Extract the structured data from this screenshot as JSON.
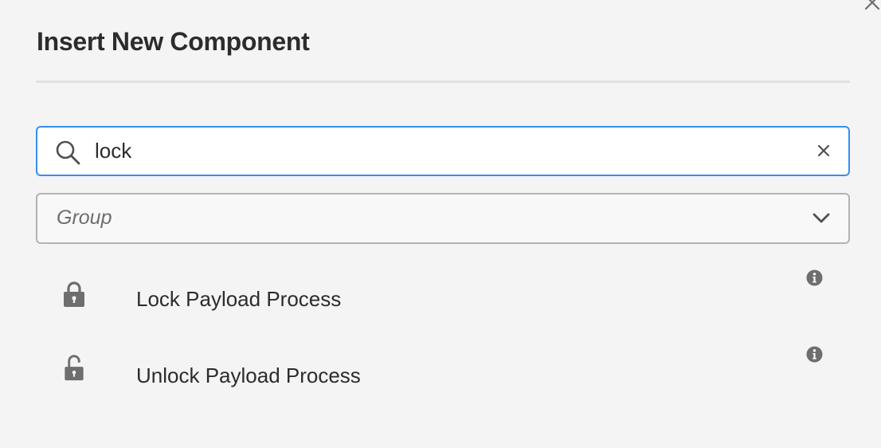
{
  "dialog": {
    "title": "Insert New Component"
  },
  "search": {
    "value": "lock",
    "placeholder": "",
    "icon": "search-icon",
    "clear_icon": "close-icon"
  },
  "group_filter": {
    "placeholder": "Group",
    "icon": "chevron-down-icon"
  },
  "results": [
    {
      "label": "Lock Payload Process",
      "icon": "lock-icon",
      "info_icon": "info-icon"
    },
    {
      "label": "Unlock Payload Process",
      "icon": "unlock-icon",
      "info_icon": "info-icon"
    }
  ],
  "colors": {
    "accent": "#378ef0",
    "background": "#f4f4f4",
    "text": "#2c2c2c",
    "icon": "#6e6e6e"
  }
}
